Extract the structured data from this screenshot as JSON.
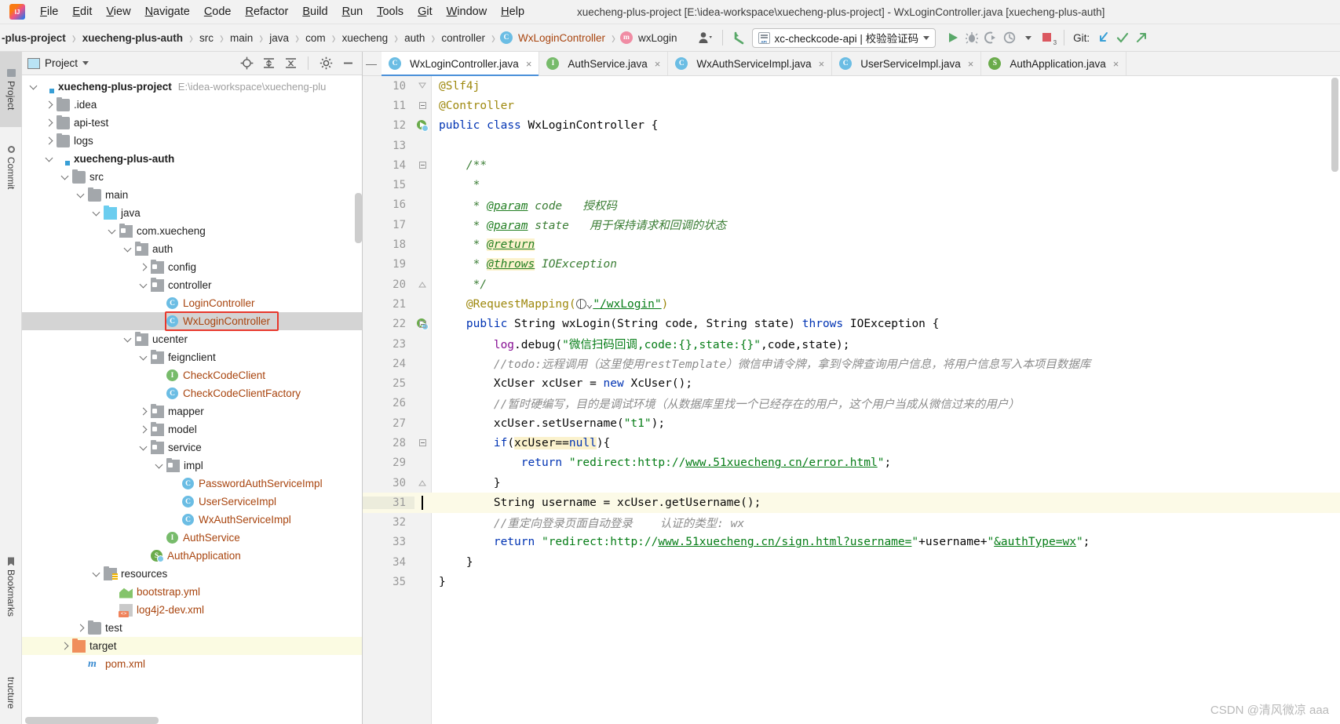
{
  "window": {
    "title": "xuecheng-plus-project [E:\\idea-workspace\\xuecheng-plus-project] - WxLoginController.java [xuecheng-plus-auth]",
    "logo_name": "intellij-idea-logo"
  },
  "menubar": {
    "items": [
      {
        "label": "File",
        "mnemonic": "F"
      },
      {
        "label": "Edit",
        "mnemonic": "E"
      },
      {
        "label": "View",
        "mnemonic": "V"
      },
      {
        "label": "Navigate",
        "mnemonic": "N"
      },
      {
        "label": "Code",
        "mnemonic": "C"
      },
      {
        "label": "Refactor",
        "mnemonic": "R"
      },
      {
        "label": "Build",
        "mnemonic": "B"
      },
      {
        "label": "Run",
        "mnemonic": "R"
      },
      {
        "label": "Tools",
        "mnemonic": "T"
      },
      {
        "label": "Git",
        "mnemonic": "G"
      },
      {
        "label": "Window",
        "mnemonic": "W"
      },
      {
        "label": "Help",
        "mnemonic": "H"
      }
    ]
  },
  "breadcrumbs": [
    {
      "label": "-plus-project",
      "bold": true,
      "kind": "project"
    },
    {
      "label": "xuecheng-plus-auth",
      "bold": true,
      "kind": "module"
    },
    {
      "label": "src",
      "bold": false,
      "kind": "dir"
    },
    {
      "label": "main",
      "bold": false,
      "kind": "dir"
    },
    {
      "label": "java",
      "bold": false,
      "kind": "dir"
    },
    {
      "label": "com",
      "bold": false,
      "kind": "dir"
    },
    {
      "label": "xuecheng",
      "bold": false,
      "kind": "dir"
    },
    {
      "label": "auth",
      "bold": false,
      "kind": "dir"
    },
    {
      "label": "controller",
      "bold": false,
      "kind": "dir"
    },
    {
      "label": "WxLoginController",
      "bold": false,
      "kind": "class",
      "badge": "C"
    },
    {
      "label": "wxLogin",
      "bold": false,
      "kind": "method",
      "badge": "m"
    }
  ],
  "toolbar": {
    "run_config": {
      "label": "xc-checkcode-api | 校验验证码",
      "icon": "api-icon"
    },
    "run_button": "run-icon",
    "debug_button": "debug-icon",
    "coverage_button": "run-with-coverage-icon",
    "profile_button": "profiler-icon",
    "stop_button": "stop-icon",
    "stop_count": "3",
    "git_label": "Git:",
    "git_update": "update-project-icon",
    "git_commit": "commit-icon",
    "git_push": "push-icon",
    "search_everywhere": "search-everywhere-icon",
    "user_icon": "user-avatar-icon",
    "back_arrow": "back-arrow-icon"
  },
  "left_strip": {
    "tabs": [
      {
        "label": "Project",
        "icon": "project-icon",
        "selected": true
      },
      {
        "label": "Commit",
        "icon": "commit-icon",
        "selected": false
      },
      {
        "label": "Bookmarks",
        "icon": "bookmarks-icon",
        "selected": false
      },
      {
        "label": "tructure",
        "icon": "structure-icon",
        "selected": false
      }
    ]
  },
  "project_panel": {
    "title": "Project",
    "header_icons": [
      "locate-icon",
      "expand-all-icon",
      "collapse-all-icon",
      "gear-icon",
      "hide-icon"
    ],
    "tree": [
      {
        "indent": 0,
        "twist": "d",
        "icon": "module",
        "label": "xuecheng-plus-project",
        "bold": true,
        "path": "E:\\idea-workspace\\xuecheng-plu"
      },
      {
        "indent": 1,
        "twist": "r",
        "icon": "folder",
        "label": ".idea"
      },
      {
        "indent": 1,
        "twist": "r",
        "icon": "folder",
        "label": "api-test"
      },
      {
        "indent": 1,
        "twist": "r",
        "icon": "folder",
        "label": "logs"
      },
      {
        "indent": 1,
        "twist": "d",
        "icon": "module",
        "label": "xuecheng-plus-auth",
        "bold": true
      },
      {
        "indent": 2,
        "twist": "d",
        "icon": "folder",
        "label": "src"
      },
      {
        "indent": 3,
        "twist": "d",
        "icon": "folder",
        "label": "main"
      },
      {
        "indent": 4,
        "twist": "d",
        "icon": "srcfolder",
        "label": "java"
      },
      {
        "indent": 5,
        "twist": "d",
        "icon": "pkg",
        "label": "com.xuecheng"
      },
      {
        "indent": 6,
        "twist": "d",
        "icon": "pkg",
        "label": "auth"
      },
      {
        "indent": 7,
        "twist": "r",
        "icon": "pkg",
        "label": "config"
      },
      {
        "indent": 7,
        "twist": "d",
        "icon": "pkg",
        "label": "controller"
      },
      {
        "indent": 8,
        "twist": "",
        "icon": "cls",
        "label": "LoginController",
        "src": true
      },
      {
        "indent": 8,
        "twist": "",
        "icon": "cls",
        "label": "WxLoginController",
        "src": true,
        "selected": true,
        "highlighted": true
      },
      {
        "indent": 6,
        "twist": "d",
        "icon": "pkg",
        "label": "ucenter"
      },
      {
        "indent": 7,
        "twist": "d",
        "icon": "pkg",
        "label": "feignclient"
      },
      {
        "indent": 8,
        "twist": "",
        "icon": "iface",
        "label": "CheckCodeClient",
        "src": true
      },
      {
        "indent": 8,
        "twist": "",
        "icon": "cls",
        "label": "CheckCodeClientFactory",
        "src": true
      },
      {
        "indent": 7,
        "twist": "r",
        "icon": "pkg",
        "label": "mapper"
      },
      {
        "indent": 7,
        "twist": "r",
        "icon": "pkg",
        "label": "model"
      },
      {
        "indent": 7,
        "twist": "d",
        "icon": "pkg",
        "label": "service"
      },
      {
        "indent": 8,
        "twist": "d",
        "icon": "pkg",
        "label": "impl"
      },
      {
        "indent": 9,
        "twist": "",
        "icon": "cls",
        "label": "PasswordAuthServiceImpl",
        "src": true
      },
      {
        "indent": 9,
        "twist": "",
        "icon": "cls",
        "label": "UserServiceImpl",
        "src": true
      },
      {
        "indent": 9,
        "twist": "",
        "icon": "cls",
        "label": "WxAuthServiceImpl",
        "src": true
      },
      {
        "indent": 8,
        "twist": "",
        "icon": "iface",
        "label": "AuthService",
        "src": true
      },
      {
        "indent": 7,
        "twist": "",
        "icon": "spring",
        "label": "AuthApplication",
        "src": true
      },
      {
        "indent": 4,
        "twist": "d",
        "icon": "resfolder",
        "label": "resources"
      },
      {
        "indent": 5,
        "twist": "",
        "icon": "yml",
        "label": "bootstrap.yml",
        "src": true
      },
      {
        "indent": 5,
        "twist": "",
        "icon": "xml",
        "label": "log4j2-dev.xml",
        "src": true
      },
      {
        "indent": 3,
        "twist": "r",
        "icon": "folder",
        "label": "test"
      },
      {
        "indent": 2,
        "twist": "r",
        "icon": "target",
        "label": "target",
        "yellow": true
      },
      {
        "indent": 3,
        "twist": "",
        "icon": "maven",
        "label": "pom.xml",
        "src": true
      }
    ]
  },
  "editor": {
    "tabs": [
      {
        "label": "WxLoginController.java",
        "badge": "C",
        "badge_kind": "class",
        "active": true,
        "close": "×"
      },
      {
        "label": "AuthService.java",
        "badge": "I",
        "badge_kind": "interface",
        "active": false,
        "close": "×"
      },
      {
        "label": "WxAuthServiceImpl.java",
        "badge": "C",
        "badge_kind": "class",
        "active": false,
        "close": "×"
      },
      {
        "label": "UserServiceImpl.java",
        "badge": "C",
        "badge_kind": "class",
        "active": false,
        "close": "×"
      },
      {
        "label": "AuthApplication.java",
        "badge": "S",
        "badge_kind": "spring",
        "active": false,
        "close": "×"
      }
    ],
    "first_line": 10,
    "lines": [
      {
        "n": 10,
        "fold": "minus-open",
        "html": "<span class=\"anno\">@Slf4j</span>"
      },
      {
        "n": 11,
        "fold": "minus",
        "html": "<span class=\"anno\">@Controller</span>"
      },
      {
        "n": 12,
        "gicon": "spring-bean-marker",
        "html": "<span class=\"kw\">public</span> <span class=\"kw\">class</span> <span class=\"typ\">WxLoginController</span> {"
      },
      {
        "n": 13,
        "html": ""
      },
      {
        "n": 14,
        "fold": "minus",
        "html": "    <span class=\"doc\">/**</span>"
      },
      {
        "n": 15,
        "html": "     <span class=\"doc\">*</span>"
      },
      {
        "n": 16,
        "html": "     <span class=\"doc\">* </span><span class=\"doctag\">@param</span><span class=\"doc\"> code   授权码</span>"
      },
      {
        "n": 17,
        "html": "     <span class=\"doc\">* </span><span class=\"doctag\">@param</span><span class=\"doc\"> state   用于保持请求和回调的状态</span>"
      },
      {
        "n": 18,
        "html": "     <span class=\"doc\">* </span><span class=\"doctag hlw\">@return</span>"
      },
      {
        "n": 19,
        "html": "     <span class=\"doc\">* </span><span class=\"doctag hlw\">@throws</span><span class=\"doc\"> IOException</span>"
      },
      {
        "n": 20,
        "fold": "minus-close",
        "html": "     <span class=\"doc\">*/</span>"
      },
      {
        "n": 21,
        "html": "    <span class=\"anno\">@RequestMapping(</span><span class=\"globe-slot\"></span><span class=\"strlink\">\"/wxLogin\"</span><span class=\"anno\">)</span>"
      },
      {
        "n": 22,
        "gicon": "spring-mapping-marker",
        "fold": "minus",
        "html": "    <span class=\"kw\">public</span> <span class=\"typ\">String</span> <span class=\"ident\">wxLogin</span>(<span class=\"typ\">String</span> code, <span class=\"typ\">String</span> state) <span class=\"kw\">throws</span> <span class=\"typ\">IOException</span> {"
      },
      {
        "n": 23,
        "html": "        <span class=\"fld\">log</span>.debug(<span class=\"str\">\"微信扫码回调,code:{},state:{}\"</span>,code,state);"
      },
      {
        "n": 24,
        "html": "        <span class=\"cmt\">//todo:远程调用（这里使用restTemplate）微信申请令牌，拿到令牌查询用户信息，将用户信息写入本项目数据库</span>"
      },
      {
        "n": 25,
        "html": "        <span class=\"typ\">XcUser</span> xcUser = <span class=\"kw\">new</span> <span class=\"typ\">XcUser</span>();"
      },
      {
        "n": 26,
        "html": "        <span class=\"cmt\">//暂时硬编写，目的是调试环境（从数据库里找一个已经存在的用户，这个用户当成从微信过来的用户）</span>"
      },
      {
        "n": 27,
        "html": "        xcUser.setUsername(<span class=\"str\">\"t1\"</span>);"
      },
      {
        "n": 28,
        "fold": "minus",
        "html": "        <span class=\"kw\">if</span>(<span class=\"hlw\">xcUser==<span class=\"kw\">null</span></span>){"
      },
      {
        "n": 29,
        "html": "            <span class=\"kw\">return</span> <span class=\"str\">\"redirect:http://</span><span class=\"strlink\">www.51xuecheng.cn/error.html</span><span class=\"str\">\"</span>;"
      },
      {
        "n": 30,
        "fold": "minus-close",
        "html": "        }"
      },
      {
        "n": 31,
        "highlight": true,
        "caret": true,
        "html": "        <span class=\"typ\">String</span> username = xcUser.getUsername();"
      },
      {
        "n": 32,
        "html": "        <span class=\"cmt\">//重定向登录页面自动登录    认证的类型: wx</span>"
      },
      {
        "n": 33,
        "html": "        <span class=\"kw\">return</span> <span class=\"str\">\"redirect:http://</span><span class=\"strlink\">www.51xuecheng.cn/sign.html?username=</span><span class=\"str\">\"</span>+username+<span class=\"str\">\"</span><span class=\"strlink\">&amp;authType=wx</span><span class=\"str\">\"</span>;"
      },
      {
        "n": 34,
        "html": "    }"
      },
      {
        "n": 35,
        "html": "}"
      }
    ]
  },
  "watermark": "CSDN @清风微凉 aaa",
  "colors": {
    "accent": "#4a90d9",
    "highlight_box": "#e8372b",
    "selection": "#d4d4d4",
    "current_line": "#fcfae7",
    "keyword": "#0033b3",
    "string": "#067d17",
    "comment": "#8c8c8c",
    "javadoc": "#3a7d34",
    "annotation": "#9e880d",
    "class_file": "#a8440e"
  }
}
